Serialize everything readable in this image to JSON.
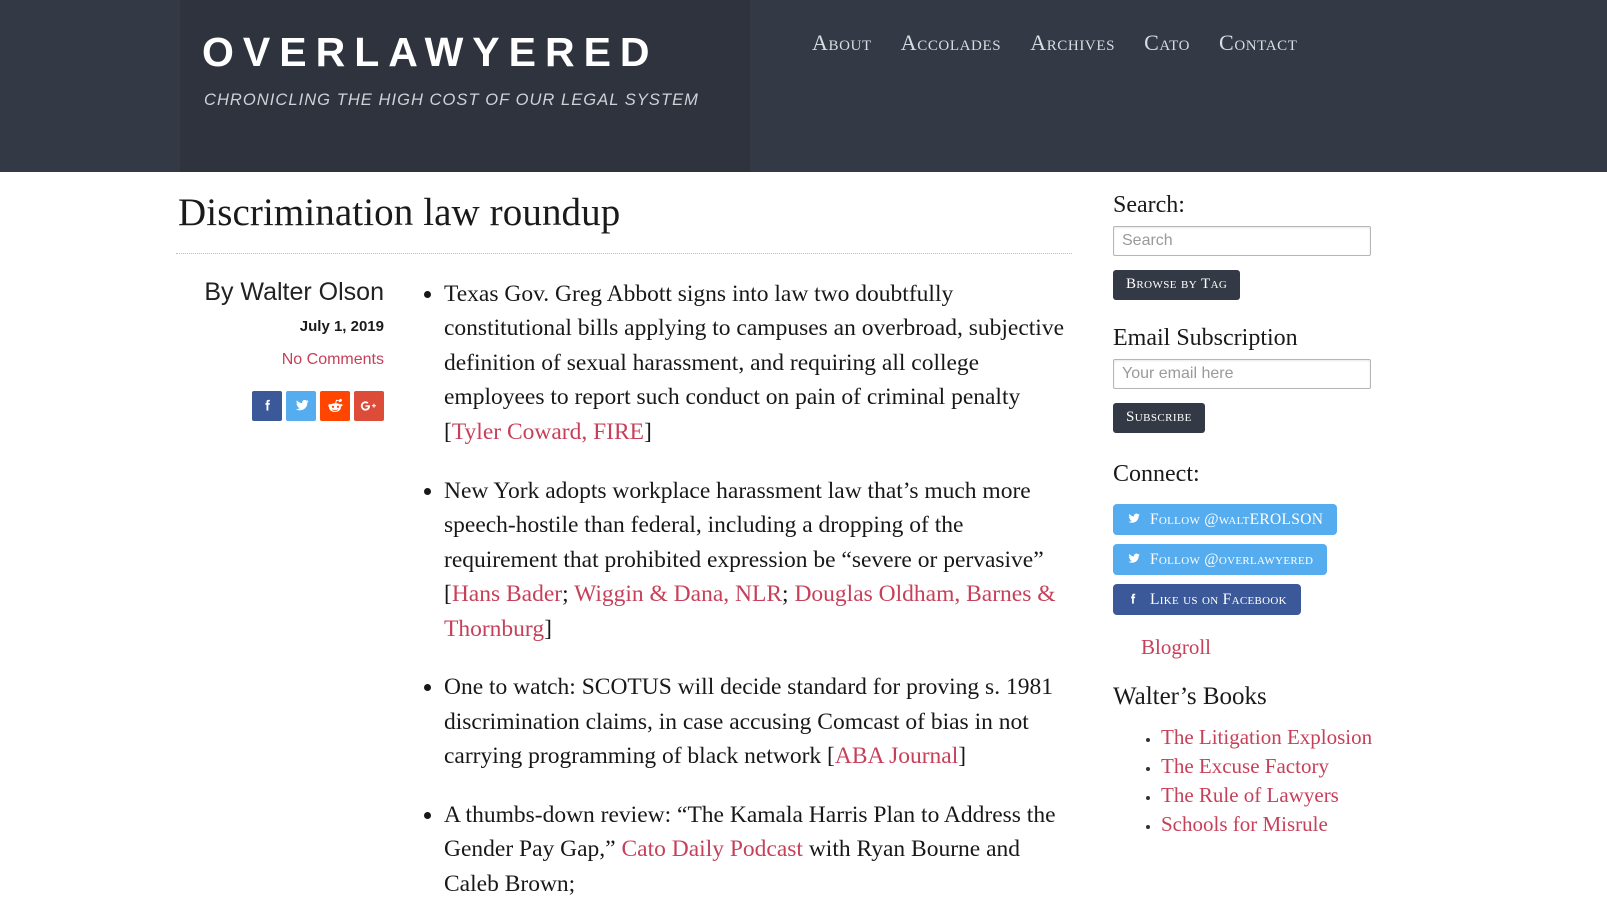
{
  "header": {
    "logo_title": "OVERLAWYERED",
    "logo_tagline": "CHRONICLING THE HIGH COST OF OUR LEGAL SYSTEM",
    "nav": [
      {
        "label": "About"
      },
      {
        "label": "Accolades"
      },
      {
        "label": "Archives"
      },
      {
        "label": "Cato"
      },
      {
        "label": "Contact"
      }
    ]
  },
  "article": {
    "title": "Discrimination law roundup",
    "author": "By Walter Olson",
    "date": "July 1, 2019",
    "comments": "No Comments",
    "share_icons": [
      {
        "name": "facebook-icon",
        "color": "#3b5998"
      },
      {
        "name": "twitter-icon",
        "color": "#55acee"
      },
      {
        "name": "reddit-icon",
        "color": "#ff4500"
      },
      {
        "name": "google-plus-icon",
        "color": "#dd4b39"
      }
    ],
    "bullets": [
      {
        "parts": [
          {
            "t": "Texas Gov. Greg Abbott signs into law two doubtfully constitutional bills applying to campuses an overbroad, subjective definition of sexual harassment, and requiring all college employees to report such conduct on pain of criminal penalty [",
            "link": false
          },
          {
            "t": "Tyler Coward, FIRE",
            "link": true
          },
          {
            "t": "]",
            "link": false
          }
        ]
      },
      {
        "parts": [
          {
            "t": "New York adopts workplace harassment law that’s much more speech-hostile than federal, including a dropping of the requirement that prohibited expression be “severe or pervasive” [",
            "link": false
          },
          {
            "t": "Hans Bader",
            "link": true
          },
          {
            "t": "; ",
            "link": false
          },
          {
            "t": "Wiggin & Dana, NLR",
            "link": true
          },
          {
            "t": "; ",
            "link": false
          },
          {
            "t": "Douglas Oldham, Barnes & Thornburg",
            "link": true
          },
          {
            "t": "]",
            "link": false
          }
        ]
      },
      {
        "parts": [
          {
            "t": "One to watch: SCOTUS will decide standard for proving s. 1981 discrimination claims, in case accusing Comcast of bias in not carrying programming of black network [",
            "link": false
          },
          {
            "t": "ABA Journal",
            "link": true
          },
          {
            "t": "]",
            "link": false
          }
        ]
      },
      {
        "parts": [
          {
            "t": "A thumbs-down review: “The Kamala Harris Plan to Address the Gender Pay Gap,” ",
            "link": false
          },
          {
            "t": "Cato Daily Podcast",
            "link": true
          },
          {
            "t": " with Ryan Bourne and Caleb Brown;",
            "link": false
          }
        ]
      }
    ]
  },
  "sidebar": {
    "search_heading": "Search:",
    "search_placeholder": "Search",
    "search_value": "",
    "browse_by_tag_label": "Browse by Tag",
    "email_heading": "Email Subscription",
    "email_placeholder": "Your email here",
    "email_value": "",
    "subscribe_label": "Subscribe",
    "connect_heading": "Connect:",
    "connect_buttons": [
      {
        "label": "Follow @waltEROLSON",
        "icon": "twitter-icon",
        "color": "#55acee"
      },
      {
        "label": "Follow @overlawyered",
        "icon": "twitter-icon",
        "color": "#55acee"
      },
      {
        "label": "Like us on Facebook",
        "icon": "facebook-icon",
        "color": "#3b5998"
      }
    ],
    "blogroll_label": "Blogroll",
    "books_heading": "Walter’s Books",
    "books": [
      {
        "label": "The Litigation Explosion"
      },
      {
        "label": "The Excuse Factory"
      },
      {
        "label": "The Rule of Lawyers"
      },
      {
        "label": "Schools for Misrule"
      }
    ]
  },
  "colors": {
    "header_bg": "#343a45",
    "logo_panel_bg": "#2f333d",
    "link_red": "#c7405a",
    "twitter_blue": "#55acee",
    "facebook_blue": "#3b5998"
  }
}
